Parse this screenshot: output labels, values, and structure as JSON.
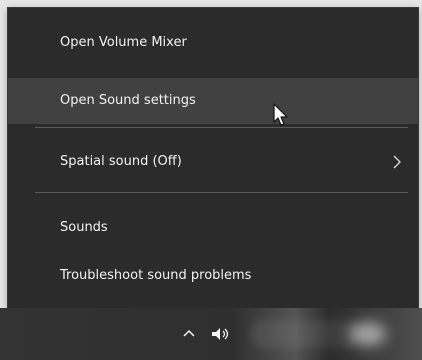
{
  "menu": {
    "items": [
      {
        "label": "Open Volume Mixer"
      },
      {
        "label": "Open Sound settings"
      },
      {
        "label": "Spatial sound (Off)"
      },
      {
        "label": "Sounds"
      },
      {
        "label": "Troubleshoot sound problems"
      }
    ]
  },
  "colors": {
    "menu_background": "#2b2b2b",
    "hover_background": "#414141",
    "text": "#f2f2f2",
    "divider": "#5a5a5a"
  },
  "taskbar": {
    "icons": [
      "chevron-up-icon",
      "speaker-icon"
    ]
  }
}
